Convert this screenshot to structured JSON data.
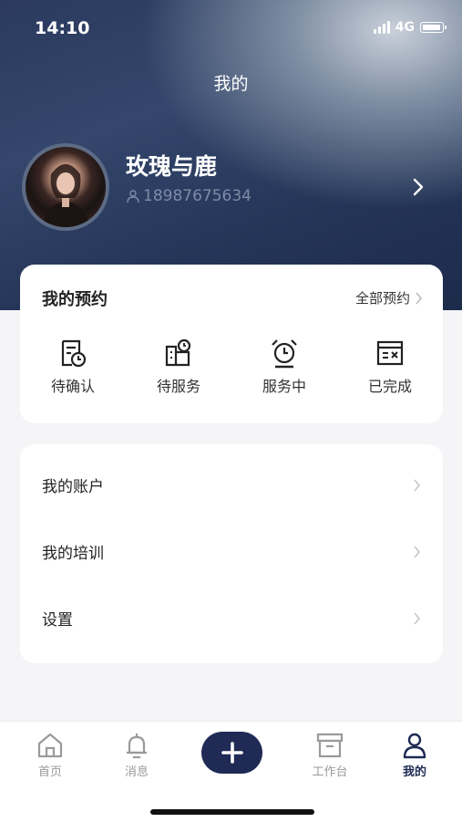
{
  "status_bar": {
    "time": "14:10",
    "network": "4G"
  },
  "header": {
    "title": "我的"
  },
  "profile": {
    "name": "玫瑰与鹿",
    "phone": "18987675634"
  },
  "appointments": {
    "title": "我的预约",
    "all_label": "全部预约",
    "items": [
      {
        "label": "待确认",
        "icon": "pending-confirm-icon"
      },
      {
        "label": "待服务",
        "icon": "pending-service-icon"
      },
      {
        "label": "服务中",
        "icon": "alarm-clock-icon"
      },
      {
        "label": "已完成",
        "icon": "completed-icon"
      }
    ]
  },
  "menu": {
    "items": [
      {
        "label": "我的账户"
      },
      {
        "label": "我的培训"
      },
      {
        "label": "设置"
      }
    ]
  },
  "tabbar": {
    "items": [
      {
        "label": "首页",
        "icon": "home-icon"
      },
      {
        "label": "消息",
        "icon": "bell-icon"
      },
      {
        "label": "工作台",
        "icon": "workbench-icon"
      },
      {
        "label": "我的",
        "icon": "person-icon",
        "active": true
      }
    ],
    "center_button": "plus-icon"
  },
  "colors": {
    "accent": "#1f2b55",
    "hero_bg": "#2b3a5e",
    "page_bg": "#f5f5f7"
  }
}
